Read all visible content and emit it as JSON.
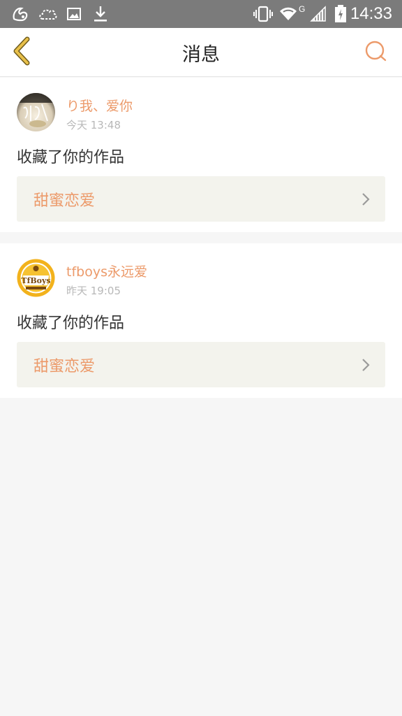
{
  "status_bar": {
    "time": "14:33",
    "network_label": "G",
    "icons": [
      "uc-browser-icon",
      "cloud-icon",
      "image-icon",
      "download-icon",
      "vibrate-icon",
      "wifi-icon",
      "signal-icon",
      "battery-icon"
    ]
  },
  "header": {
    "title": "消息",
    "back_icon": "chevron-left-icon",
    "search_icon": "search-icon"
  },
  "messages": [
    {
      "username": "り我、爱你",
      "time": "今天 13:48",
      "action": "收藏了你的作品",
      "work_title": "甜蜜恋爱"
    },
    {
      "username": "tfboys永远爱",
      "time": "昨天 19:05",
      "action": "收藏了你的作品",
      "work_title": "甜蜜恋爱"
    }
  ],
  "colors": {
    "accent": "#ec9a6a",
    "status_bar": "#7b7b7b",
    "back_icon": "#e8c04a",
    "link_bg": "#f3f3ed",
    "page_bg": "#f6f6f6"
  }
}
